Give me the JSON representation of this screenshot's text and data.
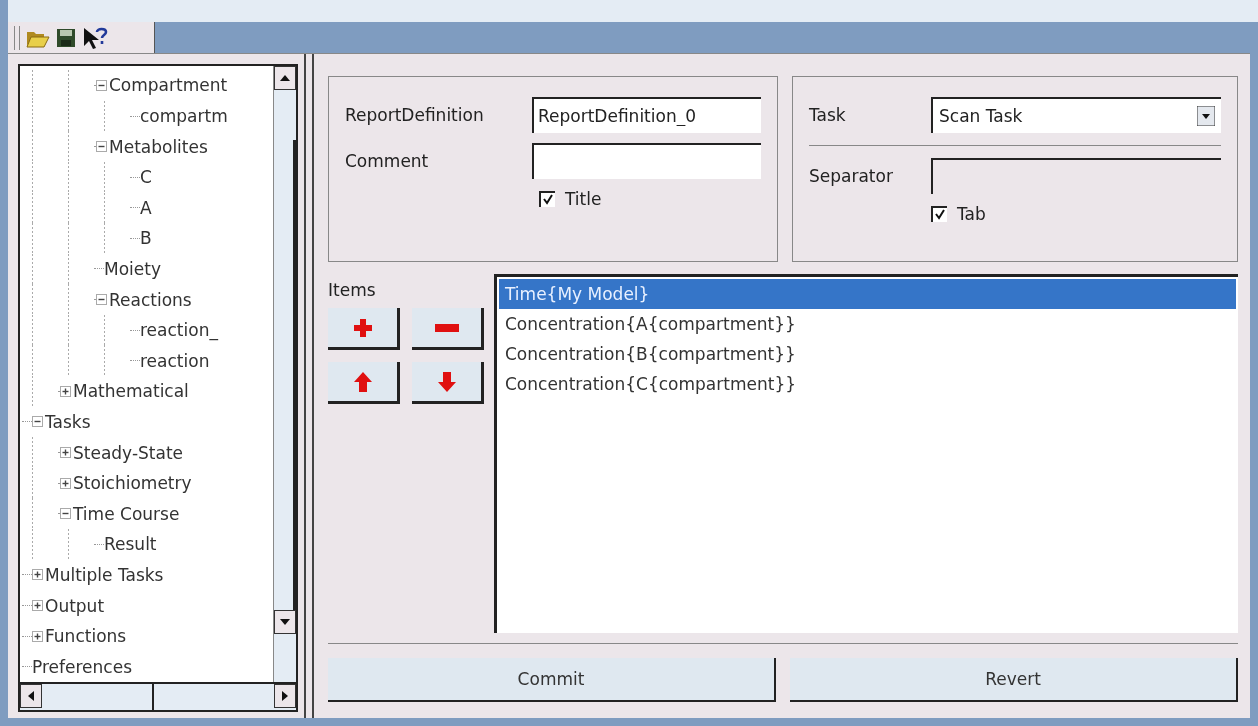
{
  "tree": [
    {
      "children": [
        {
          "children": [
            {
              "label": "Compartment",
              "expanded": true,
              "children": [
                {
                  "label": "compartm"
                }
              ]
            },
            {
              "label": "Metabolites",
              "expanded": true,
              "children": [
                {
                  "label": "C"
                },
                {
                  "label": "A"
                },
                {
                  "label": "B"
                }
              ]
            },
            {
              "label": "Moiety"
            },
            {
              "label": "Reactions",
              "expanded": true,
              "children": [
                {
                  "label": "reaction_"
                },
                {
                  "label": "reaction"
                }
              ]
            }
          ]
        },
        {
          "label": "Mathematical",
          "expanded": false
        }
      ]
    },
    {
      "label": "Tasks",
      "expanded": true,
      "children": [
        {
          "label": "Steady-State",
          "expanded": false
        },
        {
          "label": "Stoichiometry",
          "expanded": false
        },
        {
          "label": "Time Course",
          "expanded": true,
          "children": [
            {
              "label": "Result"
            }
          ]
        }
      ]
    },
    {
      "label": "Multiple Tasks",
      "expanded": false
    },
    {
      "label": "Output",
      "expanded": false
    },
    {
      "label": "Functions",
      "expanded": false
    },
    {
      "label": "Preferences"
    }
  ],
  "report": {
    "name_label": "ReportDefinition",
    "name_value": "ReportDefinition_0",
    "comment_label": "Comment",
    "title_checkbox": {
      "label": "Title",
      "checked": true
    }
  },
  "task": {
    "label": "Task",
    "value": "Scan Task",
    "separator_label": "Separator",
    "tab_checkbox": {
      "label": "Tab",
      "checked": true
    }
  },
  "items": {
    "label": "Items",
    "list": [
      {
        "text": "Time{My Model}",
        "selected": true
      },
      {
        "text": "Concentration{A{compartment}}",
        "selected": false
      },
      {
        "text": "Concentration{B{compartment}}",
        "selected": false
      },
      {
        "text": "Concentration{C{compartment}}",
        "selected": false
      }
    ]
  },
  "buttons": [
    "Commit",
    "Revert"
  ]
}
